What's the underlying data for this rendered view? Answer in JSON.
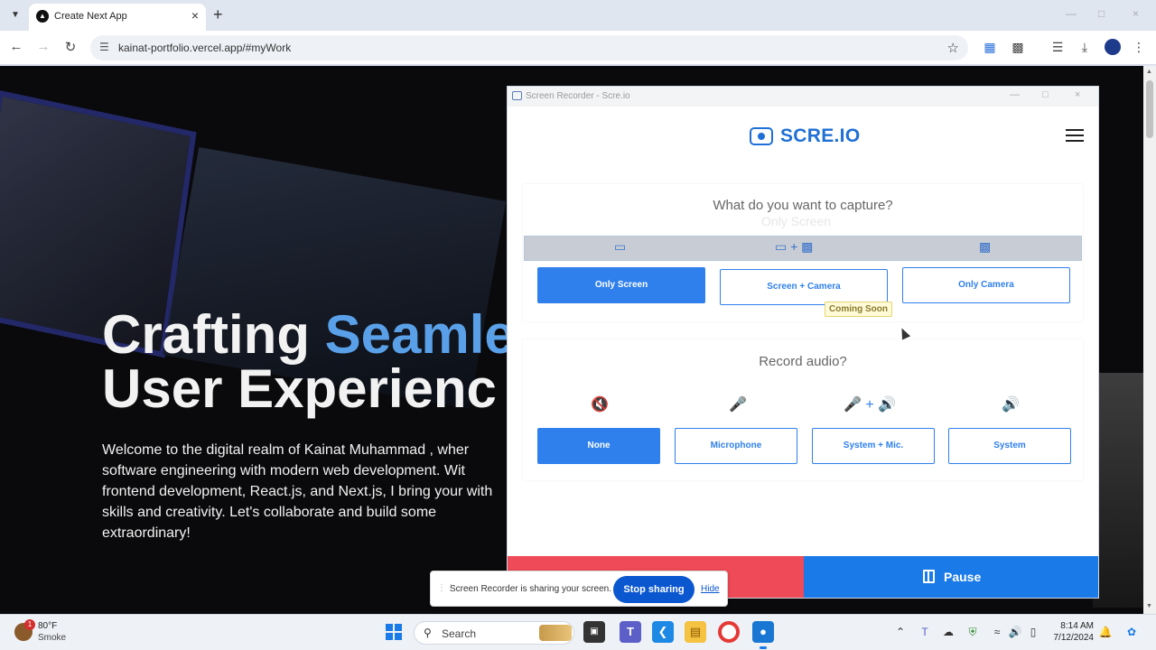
{
  "browser": {
    "tab_title": "Create Next App",
    "url": "kainat-portfolio.vercel.app/#myWork"
  },
  "page": {
    "headline_1": "Crafting ",
    "headline_1_accent": "Seamle",
    "headline_2": "User Experienc",
    "intro": "Welcome to the digital realm of Kainat Muhammad , wher software engineering with modern web development. Wit frontend development, React.js, and Next.js, I bring your with skills and creativity. Let's collaborate and build some extraordinary!"
  },
  "recorder": {
    "window_title": "Screen Recorder - Scre.io",
    "logo_text": "SCRE.IO",
    "capture_question": "What do you want to capture?",
    "capture_ghost": "Only Screen",
    "capture_options": [
      {
        "label": "Only Screen",
        "selected": true
      },
      {
        "label": "Screen + Camera",
        "selected": false
      },
      {
        "label": "Only Camera",
        "selected": false
      }
    ],
    "coming_soon": "Coming Soon",
    "audio_question": "Record audio?",
    "audio_options": [
      {
        "label": "None",
        "selected": true
      },
      {
        "label": "Microphone",
        "selected": false
      },
      {
        "label": "System + Mic.",
        "selected": false
      },
      {
        "label": "System",
        "selected": false
      }
    ],
    "pause_label": "Pause",
    "colors": {
      "accent": "#2f80ed",
      "stop": "#ef4a57",
      "pause": "#1a7be8"
    }
  },
  "sharing": {
    "message": "Screen Recorder is sharing your screen.",
    "stop_label": "Stop sharing",
    "hide_label": "Hide"
  },
  "taskbar": {
    "notification_count": "1",
    "temperature": "80°F",
    "condition": "Smoke",
    "search_label": "Search",
    "time": "8:14 AM",
    "date": "7/12/2024"
  }
}
